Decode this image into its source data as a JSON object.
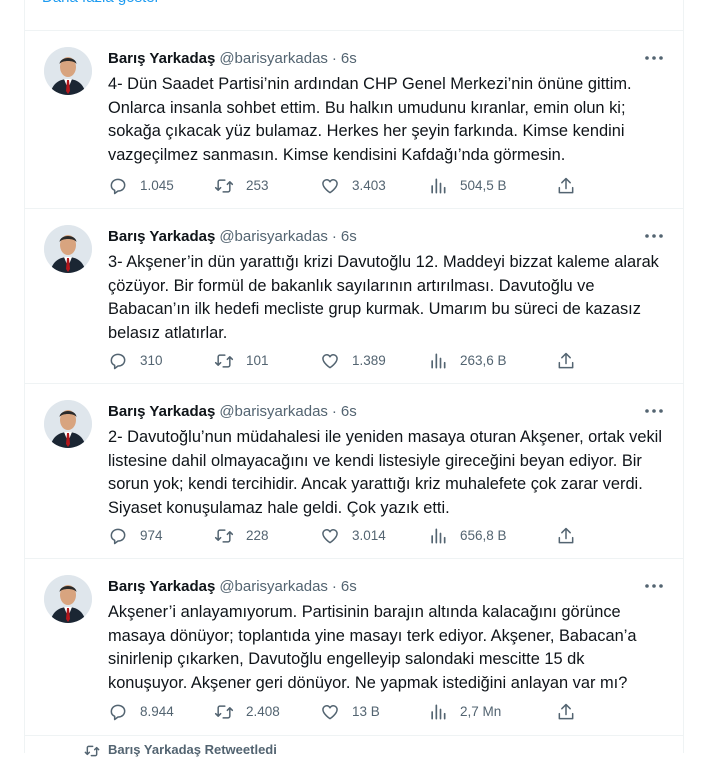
{
  "show_more": "Daha fazla göster",
  "tweets": [
    {
      "name": "Barış Yarkadaş",
      "handle": "@barisyarkadas",
      "separator": "·",
      "time": "6s",
      "text": "4- Dün Saadet Partisi’nin ardından CHP Genel Merkezi’nin önüne gittim. Onlarca insanla sohbet ettim. Bu halkın umudunu kıranlar, emin olun ki; sokağa çıkacak yüz bulamaz. Herkes her şeyin farkında. Kimse kendini vazgeçilmez sanmasın. Kimse kendisini Kafdağı’nda görmesin.",
      "replies": "1.045",
      "retweets": "253",
      "likes": "3.403",
      "views": "504,5 B"
    },
    {
      "name": "Barış Yarkadaş",
      "handle": "@barisyarkadas",
      "separator": "·",
      "time": "6s",
      "text": "3- Akşener’in dün yarattığı krizi Davutoğlu 12. Maddeyi bizzat kaleme alarak çözüyor. Bir formül de bakanlık sayılarının artırılması. Davutoğlu ve Babacan’ın ilk hedefi mecliste grup kurmak. Umarım bu süreci de kazasız belasız atlatırlar.",
      "replies": "310",
      "retweets": "101",
      "likes": "1.389",
      "views": "263,6 B"
    },
    {
      "name": "Barış Yarkadaş",
      "handle": "@barisyarkadas",
      "separator": "·",
      "time": "6s",
      "text": "2- Davutoğlu’nun müdahalesi ile yeniden masaya oturan Akşener,  ortak vekil listesine dahil olmayacağını ve kendi listesiyle gireceğini beyan ediyor. Bir sorun yok; kendi tercihidir. Ancak yarattığı kriz muhalefete çok zarar verdi. Siyaset konuşulamaz hale geldi. Çok yazık etti.",
      "replies": "974",
      "retweets": "228",
      "likes": "3.014",
      "views": "656,8 B"
    },
    {
      "name": "Barış Yarkadaş",
      "handle": "@barisyarkadas",
      "separator": "·",
      "time": "6s",
      "text": "Akşener’i anlayamıyorum. Partisinin barajın altında kalacağını görünce masaya dönüyor; toplantıda yine masayı terk ediyor. Akşener, Babacan’a sinirlenip çıkarken, Davutoğlu engelleyip salondaki mescitte 15 dk konuşuyor. Akşener geri dönüyor.  Ne yapmak istediğini anlayan var mı?",
      "replies": "8.944",
      "retweets": "2.408",
      "likes": "13 B",
      "views": "2,7 Mn"
    }
  ],
  "footer": {
    "retweeted_label": "Barış Yarkadaş Retweetledi"
  },
  "icons": {
    "reply": "reply-icon",
    "retweet": "retweet-icon",
    "like": "heart-icon",
    "views": "views-icon",
    "share": "share-icon",
    "more": "more-icon"
  },
  "colors": {
    "accent": "#1d9bf0",
    "text": "#0f1419",
    "muted": "#536471",
    "border": "#eff3f4"
  }
}
